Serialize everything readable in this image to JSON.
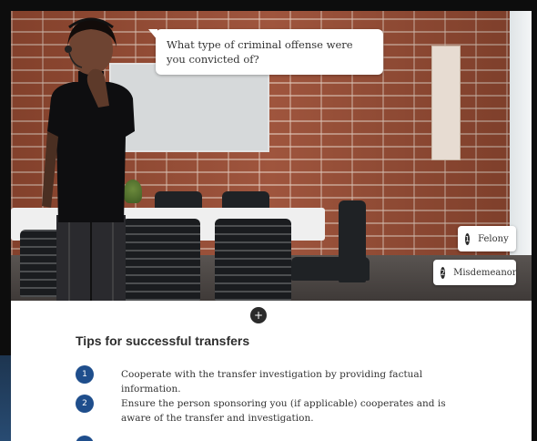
{
  "scenario": {
    "question": "What type of criminal offense were you convicted of?",
    "options": [
      {
        "number": "1",
        "label": "Felony"
      },
      {
        "number": "2",
        "label": "Misdemeanor"
      }
    ]
  },
  "expand_button": {
    "symbol": "+"
  },
  "tips": {
    "title": "Tips for successful transfers",
    "items": [
      {
        "number": "1",
        "text": "Cooperate with the transfer investigation by providing factual information."
      },
      {
        "number": "2",
        "text": "Ensure the person sponsoring you (if applicable) cooperates and is aware of the transfer and investigation."
      }
    ]
  },
  "colors": {
    "accent": "#1f4e8c",
    "dark_button": "#2b2b2b",
    "brick": "#9a4c33"
  }
}
